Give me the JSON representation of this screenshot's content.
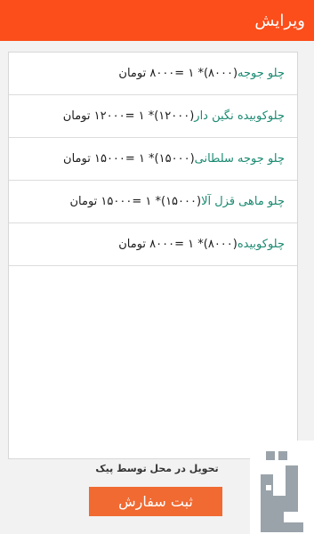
{
  "header": {
    "title": "ویرایش"
  },
  "orders": [
    {
      "name": "چلو جوجه",
      "formula": "(۸۰۰۰)* ۱ =۸۰۰۰ تومان"
    },
    {
      "name": "چلوکوبیده نگین دار",
      "formula": "(۱۲۰۰۰)* ۱ =۱۲۰۰۰ تومان"
    },
    {
      "name": "چلو جوجه سلطانی",
      "formula": "(۱۵۰۰۰)* ۱ =۱۵۰۰۰ تومان"
    },
    {
      "name": "چلو ماهی قزل آلا",
      "formula": "(۱۵۰۰۰)* ۱ =۱۵۰۰۰ تومان"
    },
    {
      "name": "چلوکوبیده",
      "formula": "(۸۰۰۰)* ۱ =۸۰۰۰ تومان"
    }
  ],
  "delivery": {
    "note": "تحویل در محل توسط پیک"
  },
  "actions": {
    "submit_label": "ثبت سفارش"
  },
  "colors": {
    "header": "#fb4e1a",
    "button": "#f06a32",
    "item_name": "#1a8a72",
    "logo": "#9aa3aa"
  },
  "logo": {
    "icon": "store-watermark-icon"
  }
}
